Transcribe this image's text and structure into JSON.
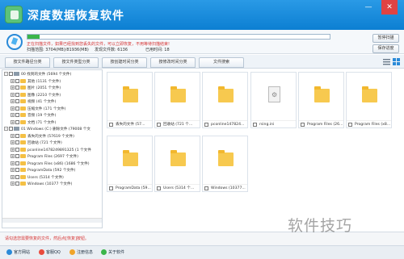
{
  "app": {
    "title": "深度数据恢复软件"
  },
  "scan": {
    "progress": 0.04,
    "status": "正在扫描文件，如果已经找到您丢失的文件，可以立即恢复，不用等待扫描结束!",
    "range_label": "扫描范围: 3704(MB)/81936(MB)",
    "found_label": "发现文件数: 6136",
    "elapsed_label": "已用时间: 18",
    "pause_button": "暂停扫描",
    "save_button": "保存进度"
  },
  "tabs": [
    "按文件路径分类",
    "按文件类型分类",
    "按创建时间分类",
    "按修改时间分类",
    "文件搜索"
  ],
  "tree": [
    {
      "label": "00 找到的文件  (5694 个文件)",
      "level": 0,
      "pm": "-"
    },
    {
      "label": "其他  (1131 个文件)",
      "level": 1,
      "pm": "+"
    },
    {
      "label": "图片  (2051 个文件)",
      "level": 1,
      "pm": "+"
    },
    {
      "label": "图像  (2210 个文件)",
      "level": 1,
      "pm": "+"
    },
    {
      "label": "视频  (41 个文件)",
      "level": 1,
      "pm": "+"
    },
    {
      "label": "压缩文件  (171 个文件)",
      "level": 1,
      "pm": "+"
    },
    {
      "label": "音频  (19 个文件)",
      "level": 1,
      "pm": "+"
    },
    {
      "label": "文档  (71 个文件)",
      "level": 1,
      "pm": "+"
    },
    {
      "label": "01 Windows (C:) 删除文件 (79008 个文",
      "level": 0,
      "pm": "-"
    },
    {
      "label": "丢失的文件  (57619 个文件)",
      "level": 1,
      "pm": "+"
    },
    {
      "label": "回收站  (721 个文件)",
      "level": 1,
      "pm": "+"
    },
    {
      "label": "pconline1478249891325  (1 个文件",
      "level": 1,
      "pm": "+"
    },
    {
      "label": "Program Files  (2697 个文件)",
      "level": 1,
      "pm": "+"
    },
    {
      "label": "Program Files (x86)  (1686 个文件)",
      "level": 1,
      "pm": "+"
    },
    {
      "label": "ProgramData  (592 个文件)",
      "level": 1,
      "pm": "+"
    },
    {
      "label": "Users  (5314 个文件)",
      "level": 1,
      "pm": "+"
    },
    {
      "label": "Windows  (10377 个文件)",
      "level": 1,
      "pm": "+"
    }
  ],
  "files": [
    {
      "name": "丢失的文件 (57...",
      "type": "folder"
    },
    {
      "name": "回收站 (721 个...",
      "type": "folder"
    },
    {
      "name": "pconline147824...",
      "type": "folder"
    },
    {
      "name": "rsing.ini",
      "type": "doc"
    },
    {
      "name": "Program Files (26...",
      "type": "folder"
    },
    {
      "name": "Program Files (x8...",
      "type": "folder"
    },
    {
      "name": "ProgramData (59...",
      "type": "folder"
    },
    {
      "name": "Users (5314 个...",
      "type": "folder"
    },
    {
      "name": "Windows (10377...",
      "type": "folder"
    }
  ],
  "status": {
    "text": "请勾选您需要恢复的文件，然后点[恢复]按钮。"
  },
  "footer": {
    "links": [
      "官方网站",
      "客服QQ",
      "注册信息",
      "关于软件"
    ]
  },
  "watermark": "软件技巧"
}
